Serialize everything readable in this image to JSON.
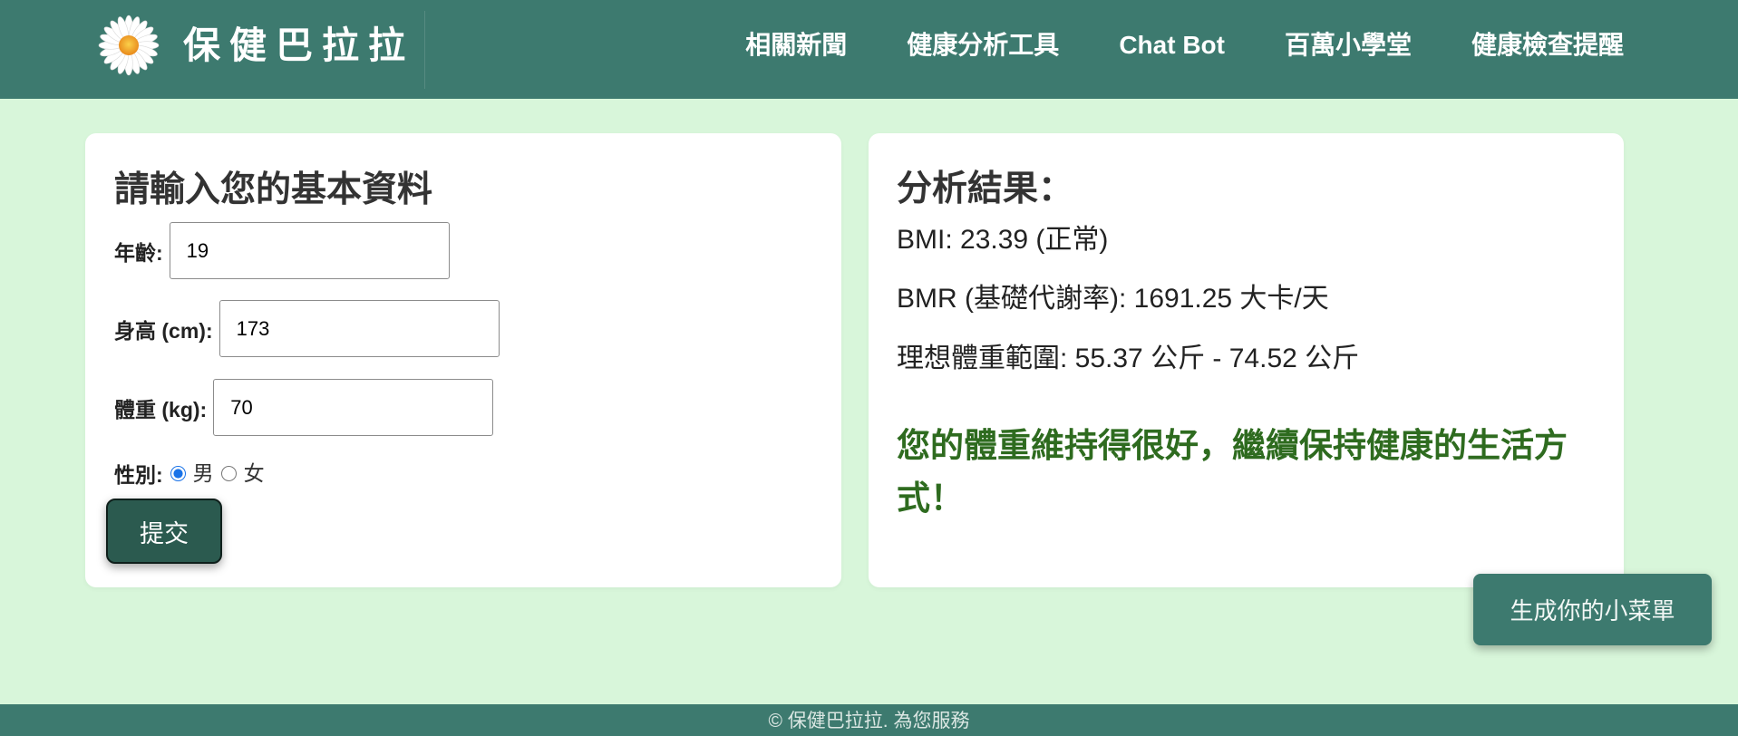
{
  "header": {
    "logo_icon": "daisy-icon",
    "logo_text": "保健巴拉拉",
    "nav": [
      {
        "label": "相關新聞"
      },
      {
        "label": "健康分析工具"
      },
      {
        "label": "Chat Bot"
      },
      {
        "label": "百萬小學堂"
      },
      {
        "label": "健康檢查提醒"
      }
    ]
  },
  "form": {
    "title": "請輸入您的基本資料",
    "age": {
      "label": "年齡:",
      "value": "19"
    },
    "height": {
      "label": "身高 (cm):",
      "value": "173"
    },
    "weight": {
      "label": "體重 (kg):",
      "value": "70"
    },
    "gender": {
      "label": "性別:",
      "options": [
        {
          "label": "男",
          "checked": true
        },
        {
          "label": "女",
          "checked": false
        }
      ]
    },
    "submit_label": "提交"
  },
  "result": {
    "title": "分析結果：",
    "bmi_line": "BMI: 23.39 (正常)",
    "bmr_line": "BMR (基礎代謝率): 1691.25 大卡/天",
    "ideal_weight_line": "理想體重範圍: 55.37 公斤 - 74.52 公斤",
    "message": "您的體重維持得很好，繼續保持健康的生活方式！"
  },
  "menu_button_label": "生成你的小菜單",
  "footer": {
    "text": "© 保健巴拉拉. 為您服務"
  },
  "colors": {
    "header_bg": "#3d7a6f",
    "page_bg": "#d8f6da",
    "submit_bg": "#2b5a4f",
    "message_text": "#2e6b1f",
    "radio_accent": "#1a73e8"
  }
}
